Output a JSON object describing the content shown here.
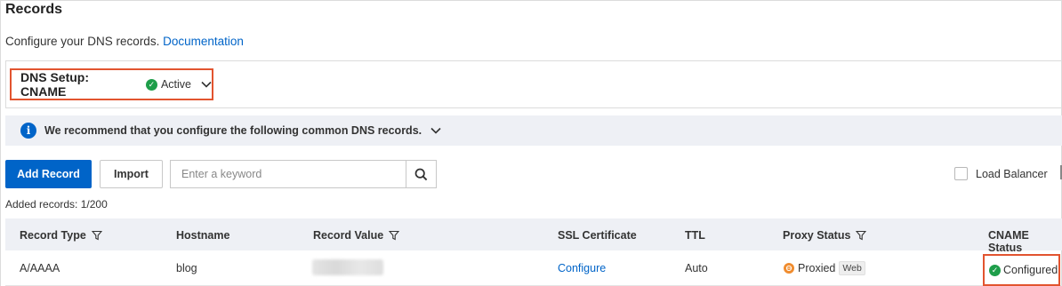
{
  "page": {
    "title": "Records",
    "subtitle": "Configure your DNS records.",
    "doc_link": "Documentation"
  },
  "dns_setup": {
    "label": "DNS Setup: CNAME",
    "status": "Active",
    "status_icon": "check-circle-icon",
    "highlight_color": "#e2542f"
  },
  "recommend": {
    "text": "We recommend that you configure the following common DNS records."
  },
  "toolbar": {
    "add_label": "Add Record",
    "import_label": "Import",
    "search_placeholder": "Enter a keyword",
    "load_balancer_label": "Load Balancer",
    "primary_color": "#0064c8"
  },
  "count_text": "Added records: 1/200",
  "table": {
    "columns": [
      "Record Type",
      "Hostname",
      "Record Value",
      "SSL Certificate",
      "TTL",
      "Proxy Status",
      "CNAME Status"
    ],
    "rows": [
      {
        "record_type": "A/AAAA",
        "hostname": "blog",
        "ssl_certificate": "Configure",
        "ttl": "Auto",
        "proxy_status": "Proxied",
        "proxy_tag": "Web",
        "cname_status": "Configured"
      }
    ]
  }
}
